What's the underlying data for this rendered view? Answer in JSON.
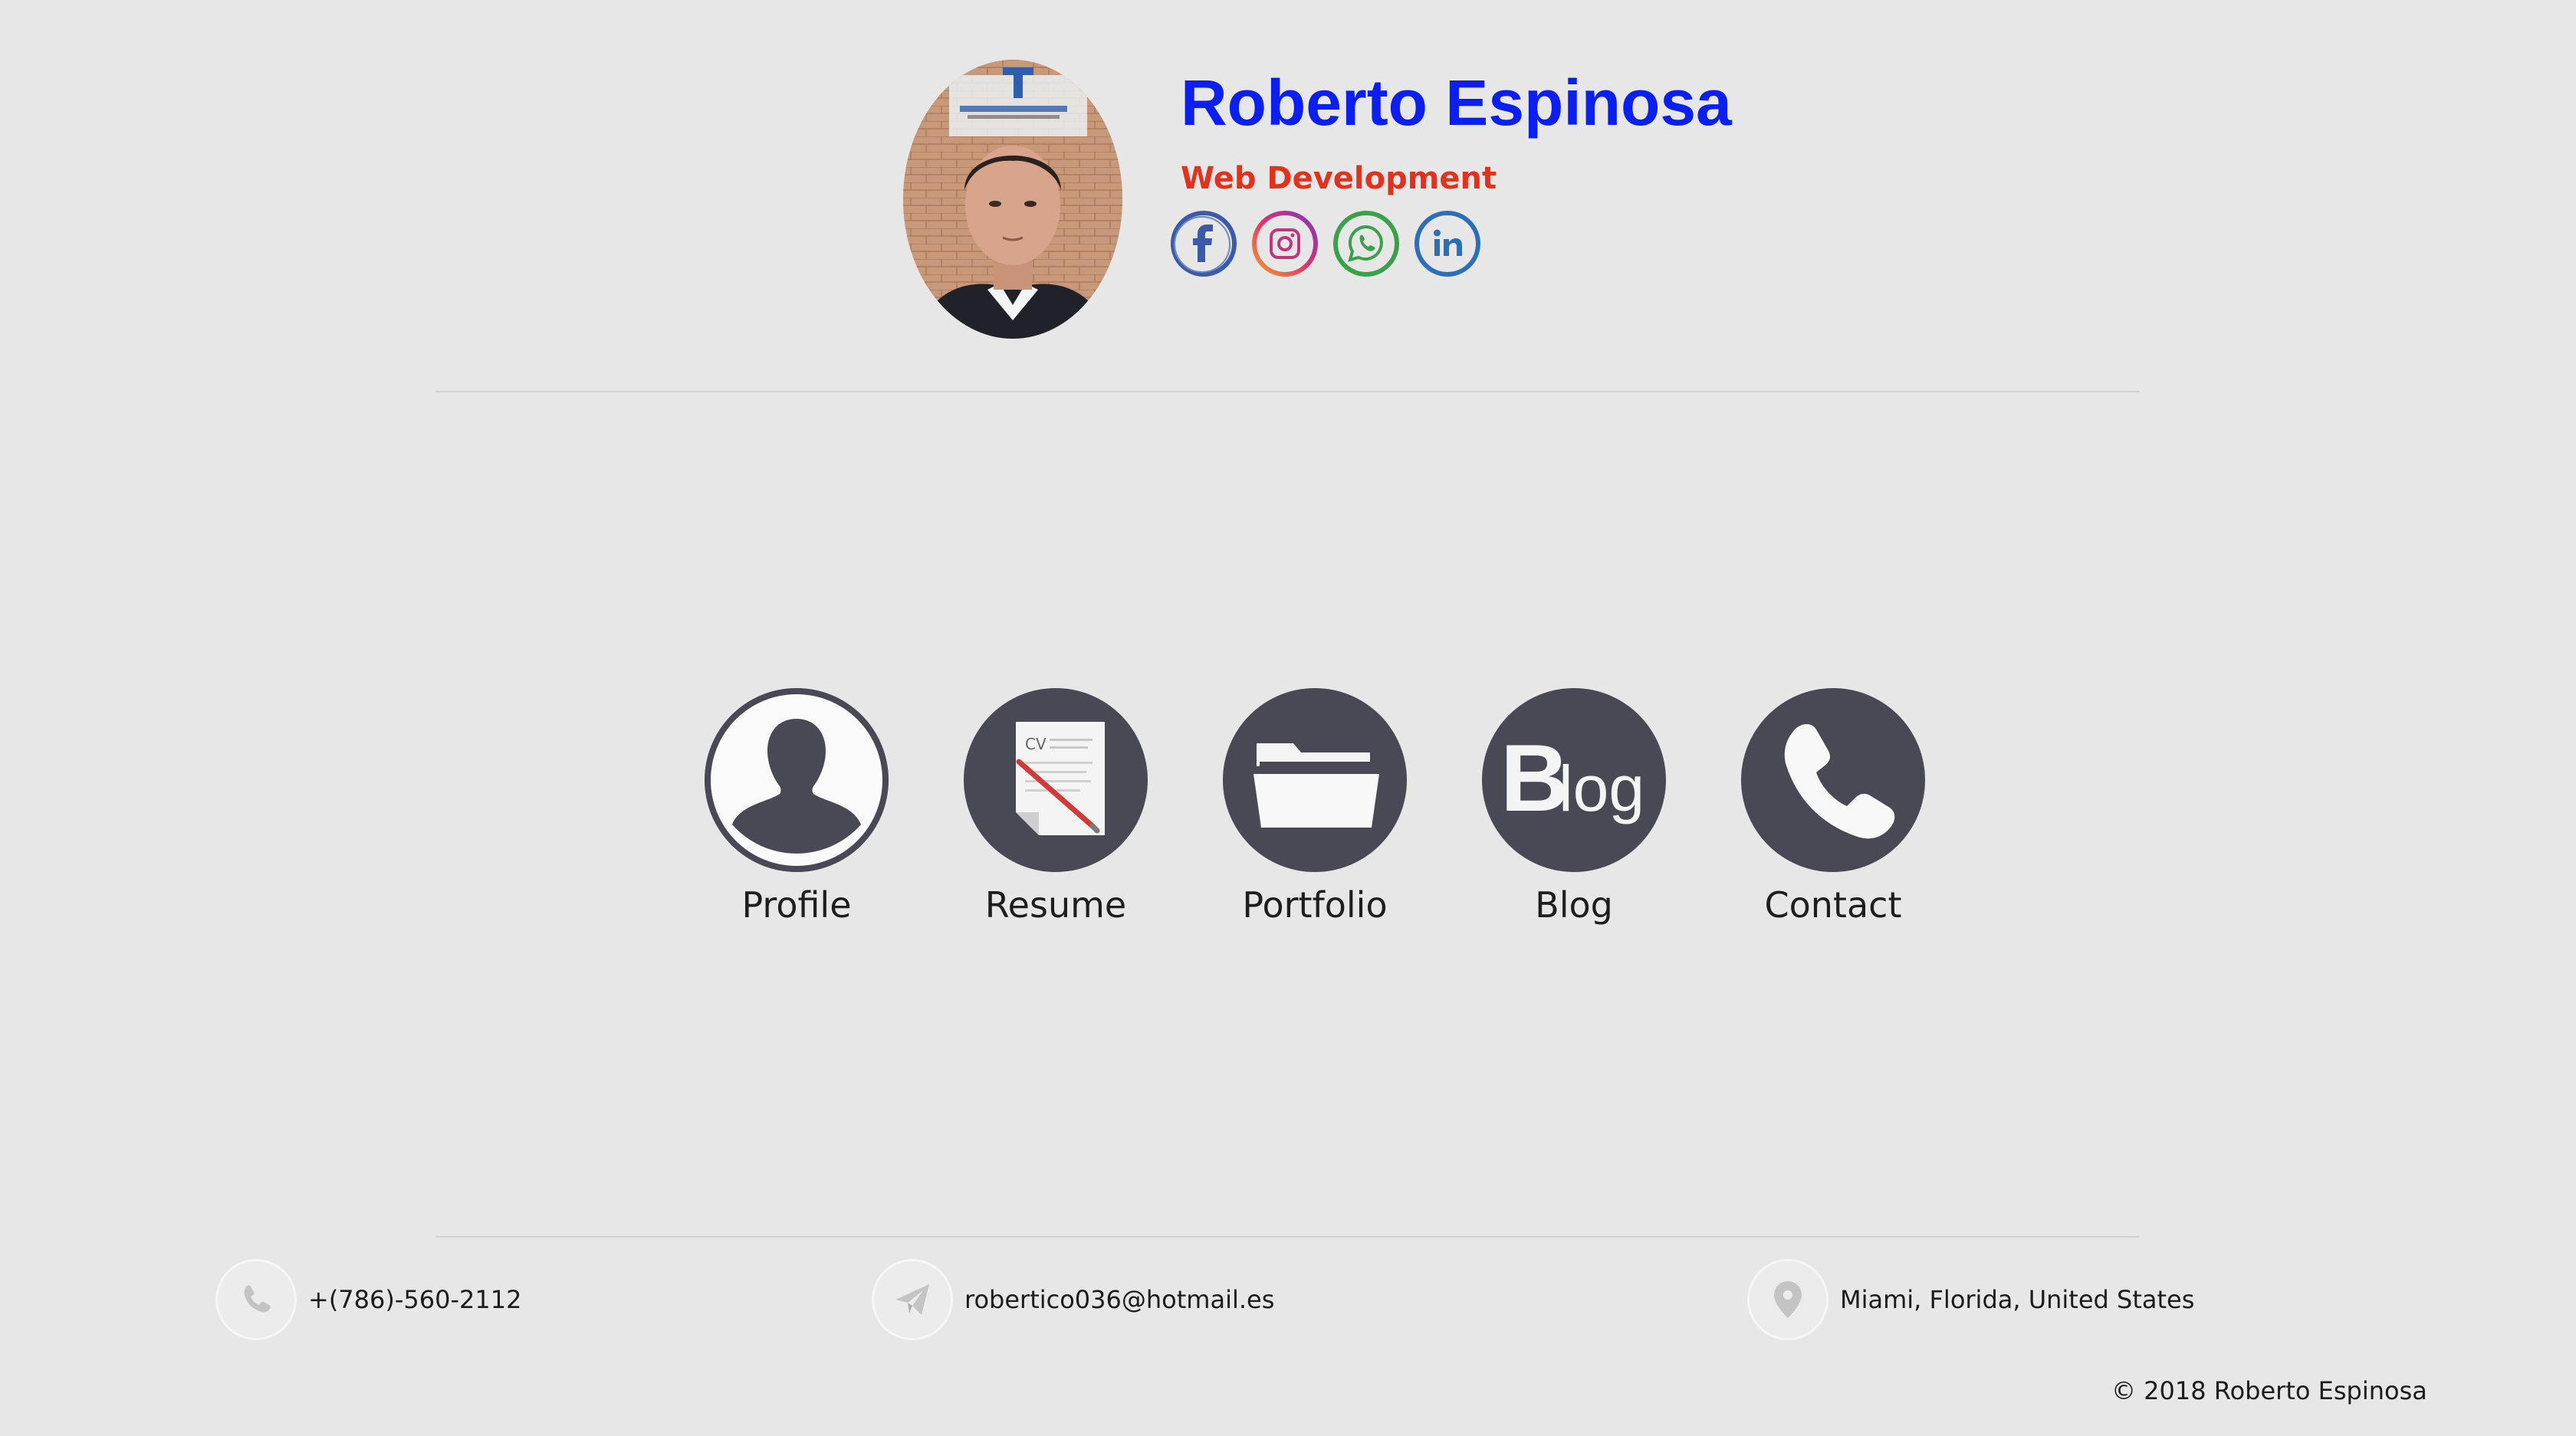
{
  "header": {
    "name": "Roberto Espinosa",
    "subtitle": "Web Development",
    "avatar_alt": "Profile photo",
    "socials": [
      {
        "name": "facebook-icon",
        "color": "#3b5aa8"
      },
      {
        "name": "instagram-icon",
        "color": "#c1357a"
      },
      {
        "name": "whatsapp-icon",
        "color": "#3aa14a"
      },
      {
        "name": "linkedin-icon",
        "color": "#2d6fb7"
      }
    ]
  },
  "nav": {
    "items": [
      {
        "label": "Profile",
        "icon": "user-silhouette-icon"
      },
      {
        "label": "Resume",
        "icon": "cv-document-icon"
      },
      {
        "label": "Portfolio",
        "icon": "folder-icon"
      },
      {
        "label": "Blog",
        "icon": "blog-logo-icon"
      },
      {
        "label": "Contact",
        "icon": "phone-icon"
      }
    ]
  },
  "footer": {
    "phone": "+(786)-560-2112",
    "email": "robertico036@hotmail.es",
    "location": "Miami, Florida, United States",
    "copyright": "© 2018 Roberto Espinosa"
  },
  "colors": {
    "background": "#e7e7e7",
    "name": "#0a1ff0",
    "subtitle": "#e2321e",
    "nav_circle": "#494955"
  }
}
